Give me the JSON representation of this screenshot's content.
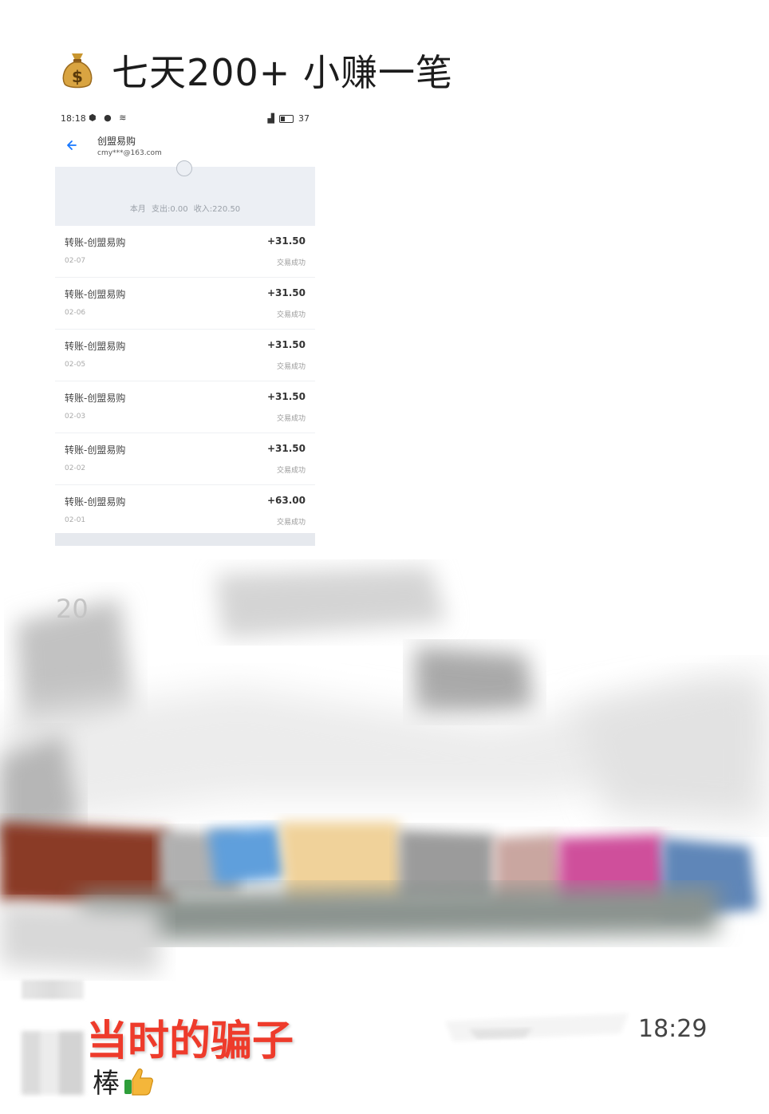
{
  "post": {
    "icon": "money-bag-icon",
    "title": "七天200+ 小赚一笔"
  },
  "phone": {
    "status_bar": {
      "time": "18:18",
      "battery": "37"
    },
    "header": {
      "app_name": "创盟易购",
      "email": "cmy***@163.com"
    },
    "summary": "本月 支出:0.00 收入:220.50",
    "transactions": [
      {
        "name": "转账-创盟易购",
        "date": "02-07",
        "amount": "+31.50",
        "status": "交易成功"
      },
      {
        "name": "转账-创盟易购",
        "date": "02-06",
        "amount": "+31.50",
        "status": "交易成功"
      },
      {
        "name": "转账-创盟易购",
        "date": "02-05",
        "amount": "+31.50",
        "status": "交易成功"
      },
      {
        "name": "转账-创盟易购",
        "date": "02-03",
        "amount": "+31.50",
        "status": "交易成功"
      },
      {
        "name": "转账-创盟易购",
        "date": "02-02",
        "amount": "+31.50",
        "status": "交易成功"
      },
      {
        "name": "转账-创盟易购",
        "date": "02-01",
        "amount": "+63.00",
        "status": "交易成功"
      }
    ]
  },
  "redacted": {
    "partial_number": "20"
  },
  "comment": {
    "label": "当时的骗子",
    "text": "棒",
    "emoji": "thumbs-up-icon",
    "time": "18:29"
  },
  "colors": {
    "label_red": "#ee3b2b",
    "link_blue": "#1677ff",
    "summary_bg": "#eceff4"
  }
}
